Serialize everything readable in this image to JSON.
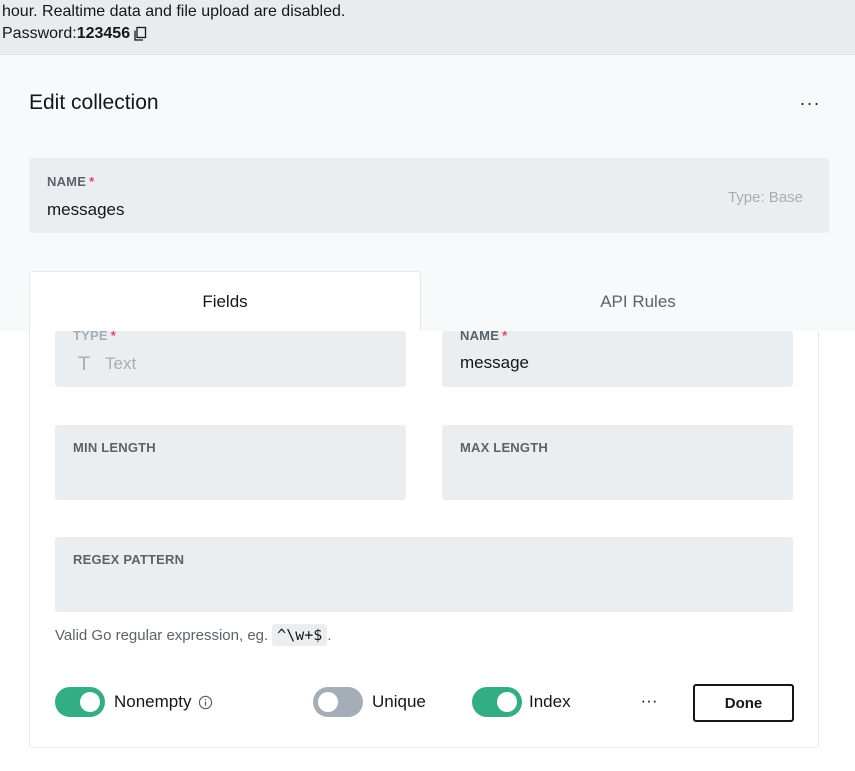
{
  "banner": {
    "line1": "hour. Realtime data and file upload are disabled.",
    "password_label": "Password:",
    "password_value": "123456",
    "copy_icon": "copy-icon"
  },
  "panel": {
    "title": "Edit collection",
    "more_label": "···"
  },
  "name_field": {
    "label": "NAME",
    "required_mark": "*",
    "value": "messages",
    "type_hint": "Type: Base"
  },
  "tabs": [
    {
      "label": "Fields",
      "active": true
    },
    {
      "label": "API Rules",
      "active": false
    }
  ],
  "field": {
    "type_label": "TYPE",
    "type_required": "*",
    "type_value": "Text",
    "type_icon": "T",
    "name_label": "NAME",
    "name_required": "*",
    "name_value": "message",
    "min_length_label": "MIN LENGTH",
    "max_length_label": "MAX LENGTH",
    "regex_label": "REGEX PATTERN",
    "regex_hint": "Valid Go regular expression, eg.",
    "regex_example": "^\\w+$",
    "regex_hint_end": "."
  },
  "toggles": {
    "nonempty_label": "Nonempty",
    "nonempty_on": true,
    "unique_label": "Unique",
    "unique_on": false,
    "index_label": "Index",
    "index_on": true
  },
  "actions": {
    "more_label": "···",
    "done_label": "Done"
  },
  "colors": {
    "accent_green": "#32ad84",
    "toggle_off": "#a5aeb6",
    "required_red": "#e34562"
  }
}
